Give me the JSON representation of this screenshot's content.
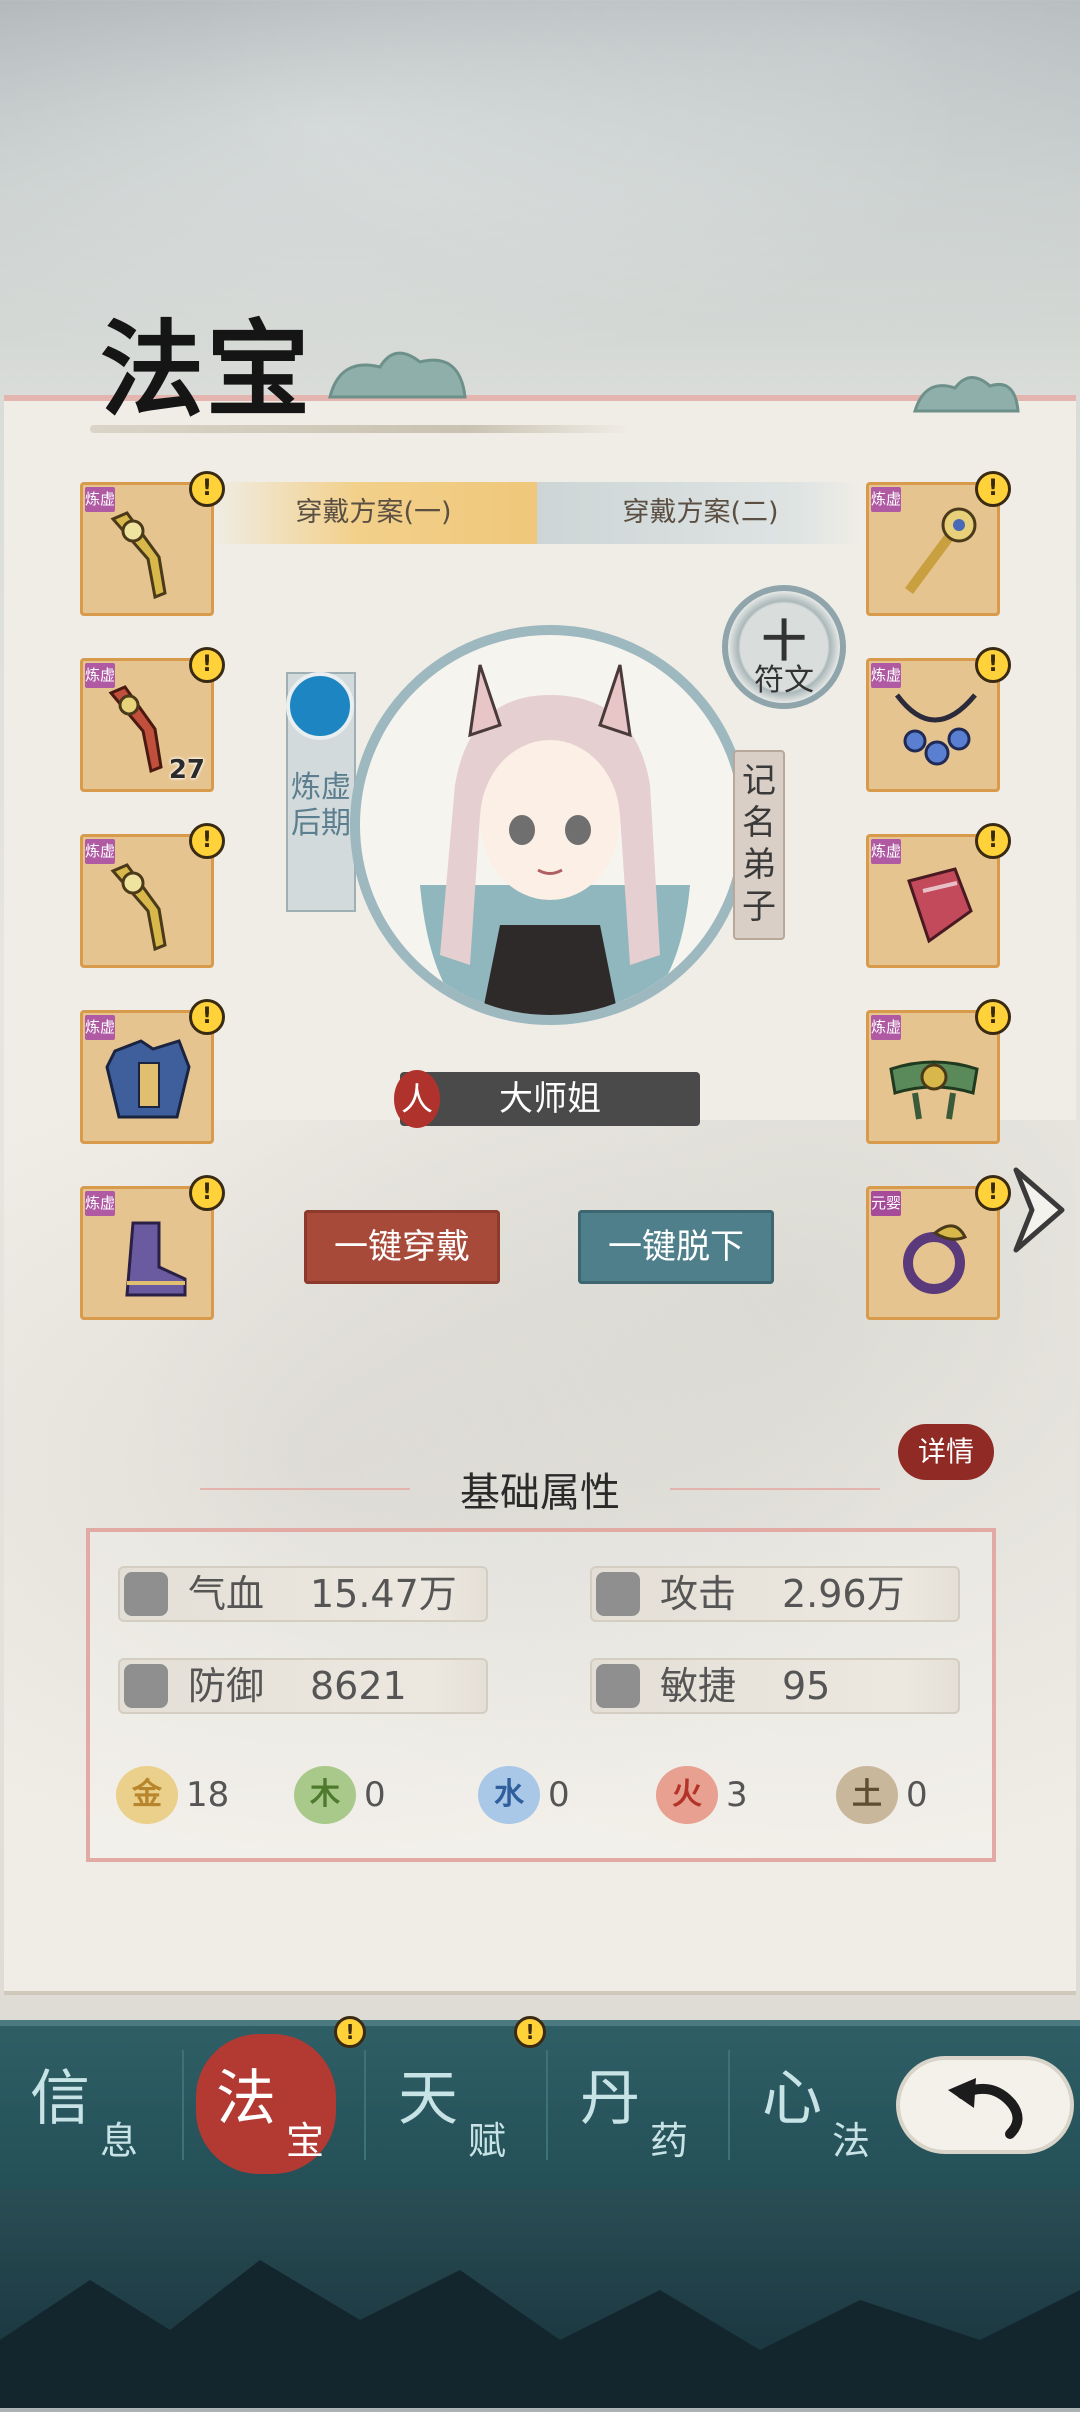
{
  "page_title": "法宝",
  "plans": {
    "tab1": "穿戴方案(一)",
    "tab2": "穿戴方案(二)"
  },
  "left_slots": [
    {
      "rank": "炼虚",
      "item": "sword",
      "warn": "!"
    },
    {
      "rank": "炼虚",
      "item": "dragon-sword",
      "warn": "!",
      "count": "27"
    },
    {
      "rank": "炼虚",
      "item": "sword",
      "warn": "!"
    },
    {
      "rank": "炼虚",
      "item": "armor",
      "warn": "!"
    },
    {
      "rank": "炼虚",
      "item": "boots",
      "warn": "!"
    }
  ],
  "right_slots": [
    {
      "rank": "炼虚",
      "item": "staff",
      "warn": "!"
    },
    {
      "rank": "炼虚",
      "item": "necklace",
      "warn": "!"
    },
    {
      "rank": "炼虚",
      "item": "bracer",
      "warn": "!"
    },
    {
      "rank": "炼虚",
      "item": "belt",
      "warn": "!"
    },
    {
      "rank": "元婴",
      "item": "ring",
      "warn": "!"
    }
  ],
  "character": {
    "realm": "炼虚后期",
    "rank": "记名弟子",
    "race": "人",
    "name": "大师姐"
  },
  "rune": {
    "plus": "十",
    "label": "符文"
  },
  "actions": {
    "wear_all": "一键穿戴",
    "take_off_all": "一键脱下"
  },
  "details_label": "详情",
  "stats": {
    "title": "基础属性",
    "items": [
      {
        "label": "气血",
        "value": "15.47万",
        "icon": "blood-drop-icon"
      },
      {
        "label": "攻击",
        "value": "2.96万",
        "icon": "attack-icon"
      },
      {
        "label": "防御",
        "value": "8621",
        "icon": "shield-icon"
      },
      {
        "label": "敏捷",
        "value": "95",
        "icon": "wind-icon"
      }
    ],
    "elements": [
      {
        "glyph": "金",
        "value": "18",
        "color": "#e0b34a"
      },
      {
        "glyph": "木",
        "value": "0",
        "color": "#7fa35a"
      },
      {
        "glyph": "水",
        "value": "0",
        "color": "#5f8fbf"
      },
      {
        "glyph": "火",
        "value": "3",
        "color": "#cc5a44"
      },
      {
        "glyph": "土",
        "value": "0",
        "color": "#8e7d65"
      }
    ]
  },
  "nav": [
    {
      "big": "信",
      "small": "息",
      "active": false,
      "warn": ""
    },
    {
      "big": "法",
      "small": "宝",
      "active": true,
      "warn": "!"
    },
    {
      "big": "天",
      "small": "赋",
      "active": false,
      "warn": "!"
    },
    {
      "big": "丹",
      "small": "药",
      "active": false,
      "warn": ""
    },
    {
      "big": "心",
      "small": "法",
      "active": false,
      "warn": ""
    }
  ],
  "colors": {
    "panel": "#f0ede6",
    "slot_bg": "#e6c490",
    "slot_border": "#d79b4b",
    "rank_tag": "#b05aa4",
    "wear_btn": "#a84a3a",
    "off_btn": "#4e7f8a",
    "nav_bg": "#2f5f66",
    "active_nav": "#b33a33",
    "warn": "#ffd23a"
  }
}
